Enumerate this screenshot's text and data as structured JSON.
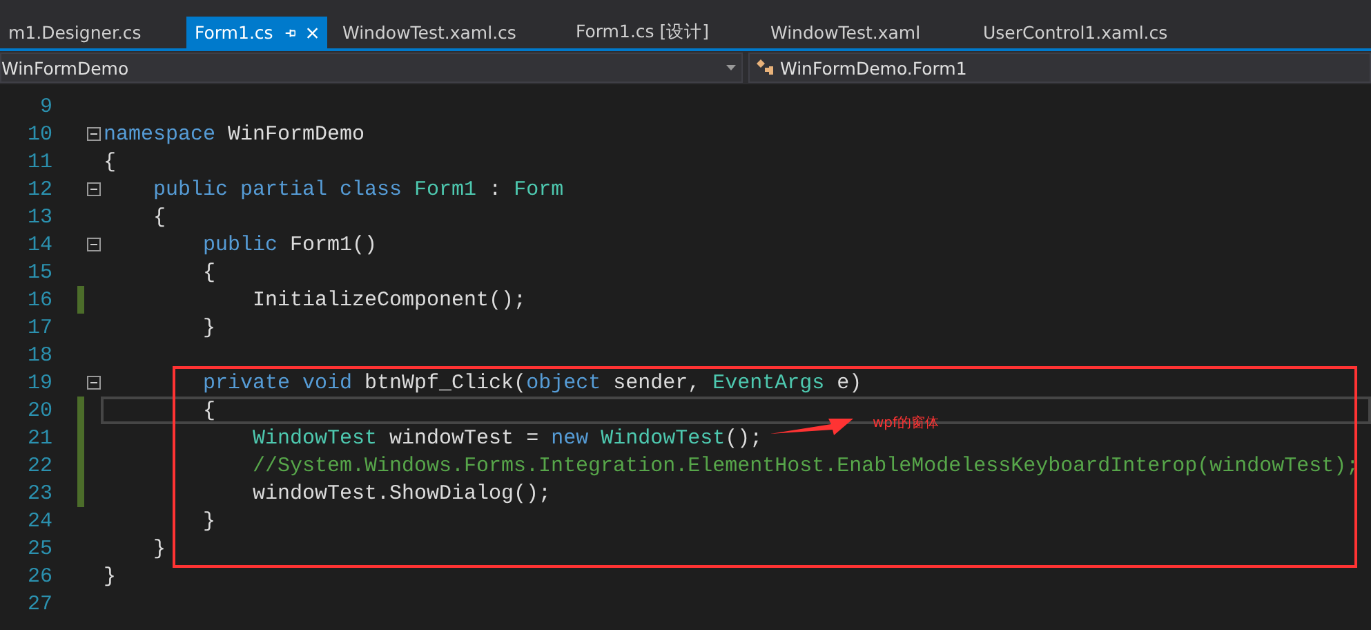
{
  "tabs": [
    {
      "label": "m1.Designer.cs",
      "selected": false
    },
    {
      "label": "Form1.cs",
      "selected": true
    },
    {
      "label": "WindowTest.xaml.cs",
      "selected": false
    },
    {
      "label": "Form1.cs [设计]",
      "selected": false
    },
    {
      "label": "WindowTest.xaml",
      "selected": false
    },
    {
      "label": "UserControl1.xaml.cs",
      "selected": false
    }
  ],
  "nav_bar": {
    "project": "WinFormDemo",
    "type": "WinFormDemo.Form1"
  },
  "editor": {
    "lines": [
      {
        "number": "9",
        "fold": false,
        "changed": false,
        "current": false
      },
      {
        "number": "10",
        "fold": true,
        "changed": false,
        "current": false,
        "tokens": [
          {
            "kind": "keyword",
            "text": "namespace"
          },
          {
            "kind": "plain",
            "text": " WinFormDemo"
          }
        ]
      },
      {
        "number": "11",
        "fold": false,
        "changed": false,
        "current": false,
        "tokens": [
          {
            "kind": "plain",
            "text": "{"
          }
        ]
      },
      {
        "number": "12",
        "fold": true,
        "changed": false,
        "current": false,
        "tokens": [
          {
            "kind": "keyword",
            "text": "    public partial class "
          },
          {
            "kind": "type",
            "text": "Form1"
          },
          {
            "kind": "plain",
            "text": " : "
          },
          {
            "kind": "type",
            "text": "Form"
          }
        ]
      },
      {
        "number": "13",
        "fold": false,
        "changed": false,
        "current": false,
        "tokens": [
          {
            "kind": "plain",
            "text": "    {"
          }
        ]
      },
      {
        "number": "14",
        "fold": true,
        "changed": false,
        "current": false,
        "tokens": [
          {
            "kind": "keyword",
            "text": "        public"
          },
          {
            "kind": "plain",
            "text": " Form1()"
          }
        ]
      },
      {
        "number": "15",
        "fold": false,
        "changed": false,
        "current": false,
        "tokens": [
          {
            "kind": "plain",
            "text": "        {"
          }
        ]
      },
      {
        "number": "16",
        "fold": false,
        "changed": true,
        "current": false,
        "tokens": [
          {
            "kind": "plain",
            "text": "            InitializeComponent();"
          }
        ]
      },
      {
        "number": "17",
        "fold": false,
        "changed": false,
        "current": false,
        "tokens": [
          {
            "kind": "plain",
            "text": "        }"
          }
        ]
      },
      {
        "number": "18",
        "fold": false,
        "changed": false,
        "current": false
      },
      {
        "number": "19",
        "fold": true,
        "changed": false,
        "current": false,
        "tokens": [
          {
            "kind": "keyword",
            "text": "        private void"
          },
          {
            "kind": "plain",
            "text": " btnWpf_Click("
          },
          {
            "kind": "keyword",
            "text": "object"
          },
          {
            "kind": "plain",
            "text": " sender, "
          },
          {
            "kind": "type",
            "text": "EventArgs"
          },
          {
            "kind": "plain",
            "text": " e)"
          }
        ]
      },
      {
        "number": "20",
        "fold": false,
        "changed": true,
        "current": true,
        "tokens": [
          {
            "kind": "plain",
            "text": "        {"
          }
        ]
      },
      {
        "number": "21",
        "fold": false,
        "changed": true,
        "current": false,
        "tokens": [
          {
            "kind": "type",
            "text": "            WindowTest"
          },
          {
            "kind": "plain",
            "text": " windowTest = "
          },
          {
            "kind": "keyword",
            "text": "new "
          },
          {
            "kind": "type",
            "text": "WindowTest"
          },
          {
            "kind": "plain",
            "text": "();"
          }
        ]
      },
      {
        "number": "22",
        "fold": false,
        "changed": true,
        "current": false,
        "tokens": [
          {
            "kind": "comment",
            "text": "            //System.Windows.Forms.Integration.ElementHost.EnableModelessKeyboardInterop(windowTest);"
          }
        ]
      },
      {
        "number": "23",
        "fold": false,
        "changed": true,
        "current": false,
        "tokens": [
          {
            "kind": "plain",
            "text": "            windowTest.ShowDialog();"
          }
        ]
      },
      {
        "number": "24",
        "fold": false,
        "changed": false,
        "current": false,
        "tokens": [
          {
            "kind": "plain",
            "text": "        }"
          }
        ]
      },
      {
        "number": "25",
        "fold": false,
        "changed": false,
        "current": false,
        "tokens": [
          {
            "kind": "plain",
            "text": "    }"
          }
        ]
      },
      {
        "number": "26",
        "fold": false,
        "changed": false,
        "current": false,
        "tokens": [
          {
            "kind": "plain",
            "text": "}"
          }
        ]
      },
      {
        "number": "27",
        "fold": false,
        "changed": false,
        "current": false
      }
    ],
    "annotation": {
      "label": "wpf的窗体"
    }
  }
}
